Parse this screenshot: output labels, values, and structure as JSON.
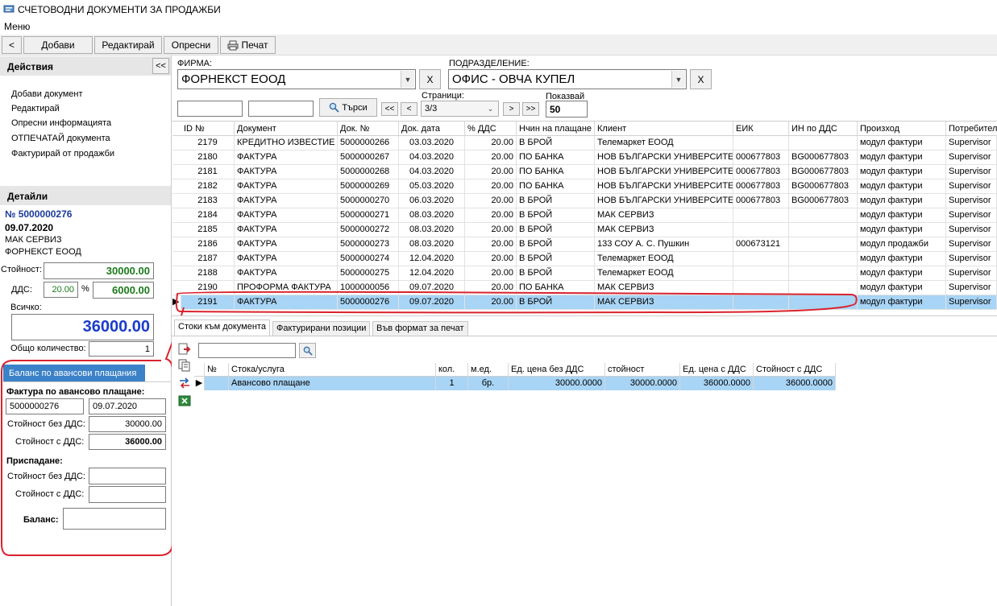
{
  "window": {
    "title": "СЧЕТОВОДНИ ДОКУМЕНТИ ЗА ПРОДАЖБИ",
    "menu": "Меню"
  },
  "toolbar": {
    "back": "<",
    "add": "Добави",
    "edit": "Редактирай",
    "refresh": "Опресни",
    "print": "Печат"
  },
  "actions": {
    "title": "Действия",
    "collapse": "<<",
    "items": [
      "Добави документ",
      "Редактирай",
      "Опресни информацията",
      "ОТПЕЧАТАЙ документа",
      "Фактурирай от продажби"
    ]
  },
  "details": {
    "title": "Детайли",
    "doc_no": "№ 5000000276",
    "date": "09.07.2020",
    "client": "МАК СЕРВИЗ",
    "firm": "ФОРНЕКСТ ЕООД",
    "value_label": "Стойност:",
    "value": "30000.00",
    "vat_label": "ДДС:",
    "vat_pct": "20.00",
    "pct_sign": "%",
    "vat_value": "6000.00",
    "total_label": "Всичко:",
    "total": "36000.00",
    "qty_label": "Общо количество:",
    "qty": "1"
  },
  "advance": {
    "tab": "Баланс по авансови плащания",
    "invoice_label": "Фактура по авансово плащане:",
    "invoice_no": "5000000276",
    "invoice_date": "09.07.2020",
    "no_vat_label": "Стойност без ДДС:",
    "no_vat": "30000.00",
    "with_vat_label": "Стойност с ДДС:",
    "with_vat": "36000.00",
    "deduct_label": "Приспадане:",
    "deduct_no_vat_label": "Стойност без ДДС:",
    "deduct_no_vat": "",
    "deduct_with_vat_label": "Стойност с ДДС:",
    "deduct_with_vat": "",
    "balance_label": "Баланс:",
    "balance": ""
  },
  "filters": {
    "firm_label": "ФИРМА:",
    "firm_value": "ФОРНЕКСТ ЕООД",
    "division_label": "ПОДРАЗДЕЛЕНИЕ:",
    "division_value": "ОФИС - ОВЧА КУПЕЛ",
    "clear": "X",
    "search1": "",
    "search2": "",
    "search_button": "Търси",
    "first": "<<",
    "prev": "<",
    "pages_label": "Страници:",
    "page": "3/3",
    "next": ">",
    "last": ">>",
    "show_label": "Показвай",
    "show_count": "50"
  },
  "grid": {
    "columns": [
      "ID №",
      "Документ",
      "Док. №",
      "Док. дата",
      "% ДДС",
      "Нчин на плащане",
      "Клиент",
      "ЕИК",
      "ИН по ДДС",
      "Произход",
      "Потребител"
    ],
    "rows": [
      [
        "2179",
        "КРЕДИТНО ИЗВЕСТИЕ",
        "5000000266",
        "03.03.2020",
        "20.00",
        "В БРОЙ",
        "Телемаркет ЕООД",
        "",
        "",
        "модул фактури",
        "Supervisor"
      ],
      [
        "2180",
        "ФАКТУРА",
        "5000000267",
        "04.03.2020",
        "20.00",
        "ПО БАНКА",
        "НОВ БЪЛГАРСКИ УНИВЕРСИТЕТ",
        "000677803",
        "BG000677803",
        "модул фактури",
        "Supervisor"
      ],
      [
        "2181",
        "ФАКТУРА",
        "5000000268",
        "04.03.2020",
        "20.00",
        "ПО БАНКА",
        "НОВ БЪЛГАРСКИ УНИВЕРСИТЕТ",
        "000677803",
        "BG000677803",
        "модул фактури",
        "Supervisor"
      ],
      [
        "2182",
        "ФАКТУРА",
        "5000000269",
        "05.03.2020",
        "20.00",
        "ПО БАНКА",
        "НОВ БЪЛГАРСКИ УНИВЕРСИТЕТ",
        "000677803",
        "BG000677803",
        "модул фактури",
        "Supervisor"
      ],
      [
        "2183",
        "ФАКТУРА",
        "5000000270",
        "06.03.2020",
        "20.00",
        "В БРОЙ",
        "НОВ БЪЛГАРСКИ УНИВЕРСИТЕТ",
        "000677803",
        "BG000677803",
        "модул фактури",
        "Supervisor"
      ],
      [
        "2184",
        "ФАКТУРА",
        "5000000271",
        "08.03.2020",
        "20.00",
        "В БРОЙ",
        "МАК СЕРВИЗ",
        "",
        "",
        "модул фактури",
        "Supervisor"
      ],
      [
        "2185",
        "ФАКТУРА",
        "5000000272",
        "08.03.2020",
        "20.00",
        "В БРОЙ",
        "МАК СЕРВИЗ",
        "",
        "",
        "модул фактури",
        "Supervisor"
      ],
      [
        "2186",
        "ФАКТУРА",
        "5000000273",
        "08.03.2020",
        "20.00",
        "В БРОЙ",
        "133 СОУ А. С. Пушкин",
        "000673121",
        "",
        "модул продажби",
        "Supervisor"
      ],
      [
        "2187",
        "ФАКТУРА",
        "5000000274",
        "12.04.2020",
        "20.00",
        "В БРОЙ",
        "Телемаркет ЕООД",
        "",
        "",
        "модул фактури",
        "Supervisor"
      ],
      [
        "2188",
        "ФАКТУРА",
        "5000000275",
        "12.04.2020",
        "20.00",
        "В БРОЙ",
        "Телемаркет ЕООД",
        "",
        "",
        "модул фактури",
        "Supervisor"
      ],
      [
        "2190",
        "ПРОФОРМА ФАКТУРА",
        "1000000056",
        "09.07.2020",
        "20.00",
        "ПО БАНКА",
        "МАК СЕРВИЗ",
        "",
        "",
        "модул фактури",
        "Supervisor"
      ],
      [
        "2191",
        "ФАКТУРА",
        "5000000276",
        "09.07.2020",
        "20.00",
        "В БРОЙ",
        "МАК СЕРВИЗ",
        "",
        "",
        "модул фактури",
        "Supervisor"
      ]
    ],
    "selected_row": 11
  },
  "lower_tabs": [
    "Стоки към документа",
    "Фактурирани позиции",
    "Във формат за печат"
  ],
  "items_search": "",
  "items_grid": {
    "columns": [
      "№",
      "Стока/услуга",
      "кол.",
      "м.ед.",
      "Ед. цена без ДДС",
      "стойност",
      "Ед. цена с ДДС",
      "Стойност с ДДС"
    ],
    "rows": [
      [
        "",
        "Авансово плащане",
        "1",
        "бр.",
        "30000.0000",
        "30000.0000",
        "36000.0000",
        "36000.0000"
      ]
    ]
  },
  "colors": {
    "selection": "#a8d4f5",
    "annotation": "#d9232d",
    "tab_active": "#3c82c8",
    "amount_green": "#1a7a1a",
    "amount_blue": "#1a3ccc"
  }
}
